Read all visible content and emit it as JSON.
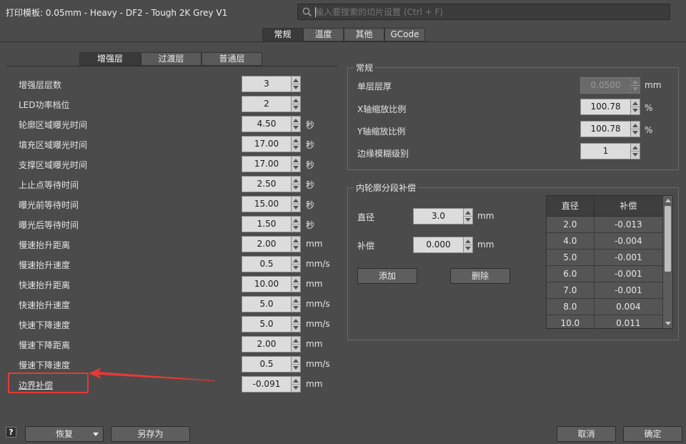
{
  "window": {
    "title": "打印模板: 0.05mm - Heavy - DF2 - Tough 2K Grey V1"
  },
  "search": {
    "placeholder": "输入要搜索的切片设置 (Ctrl + F)",
    "icon": "search-icon"
  },
  "main_tabs": [
    {
      "label": "常规",
      "active": true
    },
    {
      "label": "温度",
      "active": false
    },
    {
      "label": "其他",
      "active": false
    },
    {
      "label": "GCode",
      "active": false
    }
  ],
  "sub_tabs": [
    {
      "label": "增强层",
      "active": true
    },
    {
      "label": "过渡层",
      "active": false
    },
    {
      "label": "普通层",
      "active": false
    }
  ],
  "left_settings": [
    {
      "label": "增强层层数",
      "value": "3",
      "unit": ""
    },
    {
      "label": "LED功率档位",
      "value": "2",
      "unit": ""
    },
    {
      "label": "轮廓区域曝光时间",
      "value": "4.50",
      "unit": "秒"
    },
    {
      "label": "填充区域曝光时间",
      "value": "17.00",
      "unit": "秒"
    },
    {
      "label": "支撑区域曝光时间",
      "value": "17.00",
      "unit": "秒"
    },
    {
      "label": "上止点等待时间",
      "value": "2.50",
      "unit": "秒"
    },
    {
      "label": "曝光前等待时间",
      "value": "15.00",
      "unit": "秒"
    },
    {
      "label": "曝光后等待时间",
      "value": "1.50",
      "unit": "秒"
    },
    {
      "label": "慢速抬升距离",
      "value": "2.00",
      "unit": "mm"
    },
    {
      "label": "慢速抬升速度",
      "value": "0.5",
      "unit": "mm/s"
    },
    {
      "label": "快速抬升距离",
      "value": "10.00",
      "unit": "mm"
    },
    {
      "label": "快速抬升速度",
      "value": "5.0",
      "unit": "mm/s"
    },
    {
      "label": "快速下降速度",
      "value": "5.0",
      "unit": "mm/s"
    },
    {
      "label": "慢速下降距离",
      "value": "2.00",
      "unit": "mm"
    },
    {
      "label": "慢速下降速度",
      "value": "0.5",
      "unit": "mm/s"
    },
    {
      "label": "边界补偿",
      "value": "-0.091",
      "unit": "mm"
    }
  ],
  "general_group": {
    "title": "常规",
    "rows": [
      {
        "label": "单层层厚",
        "value": "0.0500",
        "unit": "mm",
        "disabled": true
      },
      {
        "label": "X轴缩放比例",
        "value": "100.78",
        "unit": "%",
        "disabled": false
      },
      {
        "label": "Y轴缩放比例",
        "value": "100.78",
        "unit": "%",
        "disabled": false
      },
      {
        "label": "边缘模糊级别",
        "value": "1",
        "unit": "",
        "disabled": false
      }
    ]
  },
  "inner_group": {
    "title": "内轮廓分段补偿",
    "diameter_label": "直径",
    "diameter_value": "3.0",
    "diameter_unit": "mm",
    "comp_label": "补偿",
    "comp_value": "0.000",
    "comp_unit": "mm",
    "add_label": "添加",
    "delete_label": "删除",
    "table": {
      "headers": [
        "直径",
        "补偿"
      ],
      "rows": [
        [
          "2.0",
          "-0.013"
        ],
        [
          "4.0",
          "-0.004"
        ],
        [
          "5.0",
          "-0.001"
        ],
        [
          "6.0",
          "-0.001"
        ],
        [
          "7.0",
          "-0.001"
        ],
        [
          "8.0",
          "0.004"
        ],
        [
          "10.0",
          "0.011"
        ]
      ]
    }
  },
  "footer": {
    "help_label": "?",
    "restore_label": "恢复",
    "save_as_label": "另存为",
    "cancel_label": "取消",
    "ok_label": "确定"
  },
  "colors": {
    "background": "#4b4b4b",
    "highlight": "#e53a35"
  }
}
